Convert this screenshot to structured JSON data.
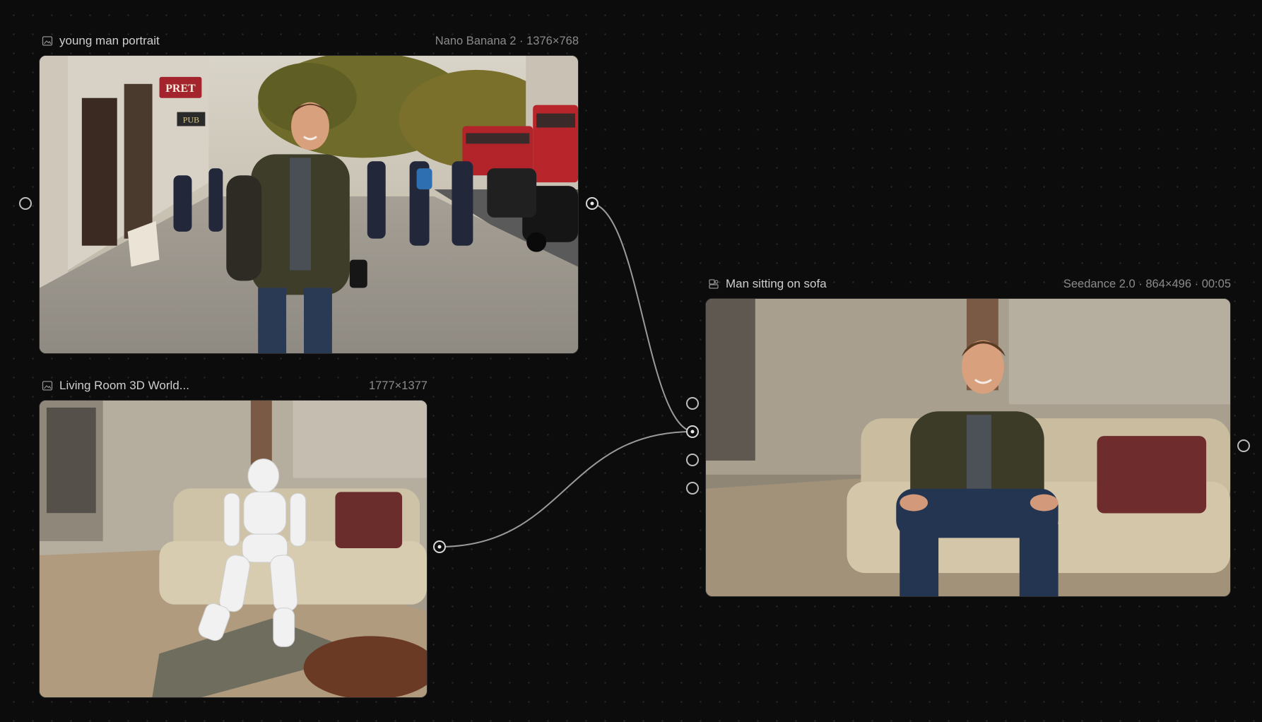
{
  "nodes": {
    "portrait": {
      "title": "young man portrait",
      "meta": "Nano Banana 2 · 1376×768",
      "icon": "image-icon"
    },
    "living_room": {
      "title": "Living Room 3D World...",
      "meta": "1777×1377",
      "icon": "image-icon"
    },
    "video": {
      "title": "Man sitting on sofa",
      "meta": "Seedance 2.0 · 864×496 · 00:05",
      "icon": "video-node-icon"
    }
  },
  "portrait_scene": {
    "shop_sign": "PRET",
    "pub_sign": "PUB"
  },
  "colors": {
    "background": "#0c0c0c",
    "wire": "#9a9a9a",
    "handle": "#d6d6d6"
  }
}
